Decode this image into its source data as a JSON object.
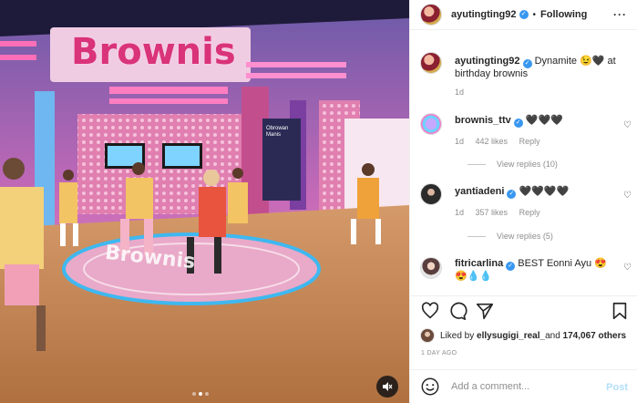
{
  "header": {
    "username": "ayutingting92",
    "separator": "•",
    "follow_label": "Following",
    "more_icon": "more-horizontal-icon"
  },
  "media": {
    "studio_sign": "Brownis",
    "tv_label": "Obrowan Manis",
    "floor_text": "Brownis",
    "mute_icon": "speaker-muted-icon",
    "carousel_dots": 3,
    "active_dot": 1
  },
  "caption": {
    "username": "ayutingting92",
    "text": "Dynamite 😉🖤 at birthday brownis",
    "time": "1d"
  },
  "comments": [
    {
      "username": "brownis_ttv",
      "verified": true,
      "text": "🖤🖤🖤",
      "time": "1d",
      "likes": "442 likes",
      "reply_label": "Reply",
      "view_replies": "View replies (10)"
    },
    {
      "username": "yantiadeni",
      "verified": true,
      "text": "🖤🖤🖤🖤",
      "time": "1d",
      "likes": "357 likes",
      "reply_label": "Reply",
      "view_replies": "View replies (5)"
    },
    {
      "username": "fitricarlina",
      "verified": true,
      "text": "BEST Eonni Ayu 😍😍💧💧"
    }
  ],
  "likes": {
    "prefix": "Liked by ",
    "user": "ellysugigi_real_",
    "middle": " and ",
    "count": "174,067 others"
  },
  "date": "1 DAY AGO",
  "add_comment": {
    "placeholder": "Add a comment...",
    "post_label": "Post"
  },
  "colors": {
    "verified": "#3897f0",
    "post_disabled": "#b2dffc",
    "meta_text": "#8e8e8e"
  }
}
